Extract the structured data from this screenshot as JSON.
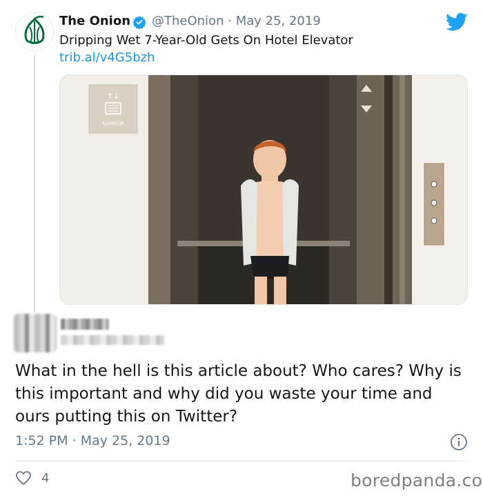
{
  "tweet": {
    "author_name": "The Onion",
    "author_handle": "@TheOnion",
    "separator": "·",
    "date": "May 25, 2019",
    "text": "Dripping Wet 7-Year-Old Gets On Hotel Elevator",
    "link": "trib.al/v4G5bzh",
    "image": {
      "elevator_sign": "ELEVATOR"
    }
  },
  "reply": {
    "text": "What in the hell is this article about? Who cares? Why is this important and why did you waste your time and ours putting this on Twitter?",
    "time": "1:52 PM",
    "separator": "·",
    "date": "May 25, 2019",
    "like_count": "4"
  },
  "watermark": "boredpanda.com",
  "colors": {
    "link": "#1b95e0",
    "verified": "#1da1f2",
    "twitter_brand": "#1da1f2",
    "onion_green": "#006b3a"
  },
  "icons": [
    "onion-logo-icon",
    "verified-badge-icon",
    "twitter-bird-icon",
    "info-icon",
    "heart-icon"
  ]
}
